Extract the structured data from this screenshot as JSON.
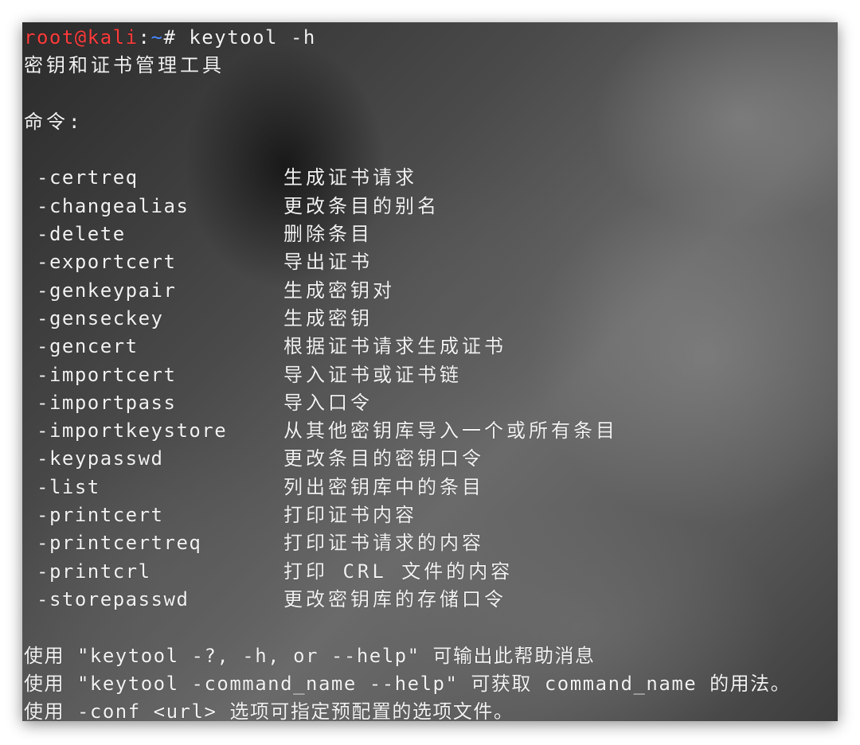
{
  "prompt": {
    "user_host": "root@kali",
    "separator": ":",
    "path": "~",
    "symbol": "#",
    "command": " keytool -h"
  },
  "title": "密钥和证书管理工具",
  "commands_header": "命令:",
  "commands": [
    {
      "name": "-certreq",
      "desc": "生成证书请求"
    },
    {
      "name": "-changealias",
      "desc": "更改条目的别名"
    },
    {
      "name": "-delete",
      "desc": "删除条目"
    },
    {
      "name": "-exportcert",
      "desc": "导出证书"
    },
    {
      "name": "-genkeypair",
      "desc": "生成密钥对"
    },
    {
      "name": "-genseckey",
      "desc": "生成密钥"
    },
    {
      "name": "-gencert",
      "desc": "根据证书请求生成证书"
    },
    {
      "name": "-importcert",
      "desc": "导入证书或证书链"
    },
    {
      "name": "-importpass",
      "desc": "导入口令"
    },
    {
      "name": "-importkeystore",
      "desc": "从其他密钥库导入一个或所有条目"
    },
    {
      "name": "-keypasswd",
      "desc": "更改条目的密钥口令"
    },
    {
      "name": "-list",
      "desc": "列出密钥库中的条目"
    },
    {
      "name": "-printcert",
      "desc": "打印证书内容"
    },
    {
      "name": "-printcertreq",
      "desc": "打印证书请求的内容"
    },
    {
      "name": "-printcrl",
      "desc": "打印 CRL 文件的内容"
    },
    {
      "name": "-storepasswd",
      "desc": "更改密钥库的存储口令"
    }
  ],
  "footer": [
    "使用 \"keytool -?, -h, or --help\" 可输出此帮助消息",
    "使用 \"keytool -command_name --help\" 可获取 command_name 的用法。",
    "使用 -conf <url> 选项可指定预配置的选项文件。"
  ],
  "colors": {
    "prompt_user": "#ff3b3b",
    "prompt_path": "#4a8cff",
    "text": "#f2f2f2"
  }
}
